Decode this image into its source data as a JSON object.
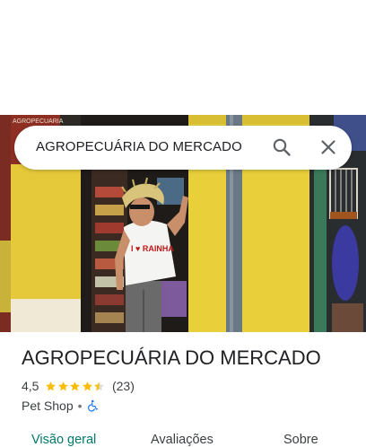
{
  "search": {
    "query": "AGROPECUÁRIA DO MERCADO"
  },
  "place": {
    "name": "AGROPECUÁRIA DO MERCADO",
    "rating": "4,5",
    "stars": 4.5,
    "review_count": "(23)",
    "category": "Pet Shop",
    "separator": "•"
  },
  "tabs": [
    {
      "label": "Visão geral",
      "active": true
    },
    {
      "label": "Avaliações",
      "active": false
    },
    {
      "label": "Sobre",
      "active": false
    }
  ],
  "photo": {
    "shop_sign": "AGROPECUARIA",
    "shirt_text": "I ♥ RAINHA"
  },
  "colors": {
    "accent": "#00796b",
    "star": "#fbbc04",
    "wall_yellow": "#e9cf3a"
  }
}
